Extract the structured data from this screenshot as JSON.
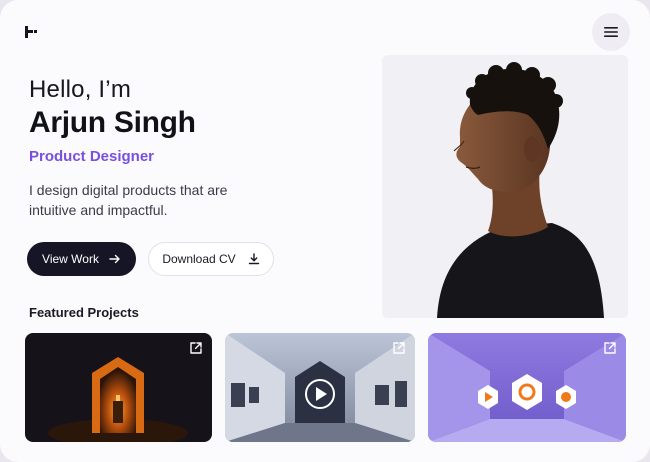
{
  "header": {
    "logo_icon": "brand-logo",
    "menu_icon": "hamburger-menu-icon"
  },
  "hero": {
    "greeting": "Hello, I’m",
    "name": "Arjun Singh",
    "role": "Product Designer",
    "intro": "I design digital products that are intuitive and impactful.",
    "accent_color": "#7a4fe0"
  },
  "actions": {
    "primary_label": "View Work",
    "primary_icon": "arrow-right-icon",
    "secondary_label": "Download CV",
    "secondary_icon": "download-icon"
  },
  "featured": {
    "title": "Featured Projects",
    "projects": [
      {
        "theme": "dark-orange-arch",
        "icon": "external-link-icon"
      },
      {
        "theme": "grey-gallery-video",
        "icon": "external-link-icon"
      },
      {
        "theme": "purple-3d-icons",
        "icon": "external-link-icon"
      }
    ]
  }
}
